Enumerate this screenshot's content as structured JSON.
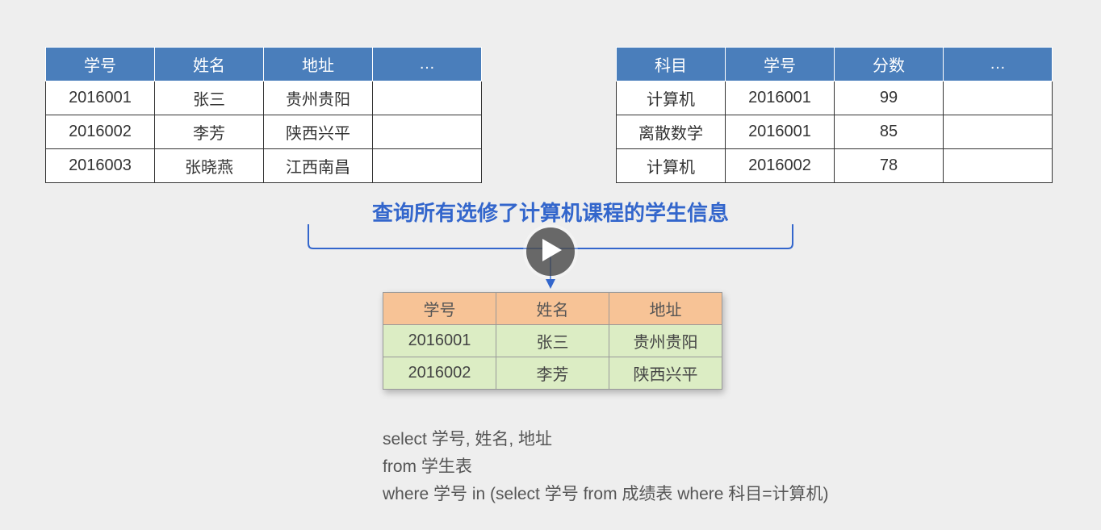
{
  "student_table": {
    "headers": [
      "学号",
      "姓名",
      "地址",
      "…"
    ],
    "rows": [
      [
        "2016001",
        "张三",
        "贵州贵阳",
        ""
      ],
      [
        "2016002",
        "李芳",
        "陕西兴平",
        ""
      ],
      [
        "2016003",
        "张晓燕",
        "江西南昌",
        ""
      ]
    ]
  },
  "score_table": {
    "headers": [
      "科目",
      "学号",
      "分数",
      "…"
    ],
    "rows": [
      [
        "计算机",
        "2016001",
        "99",
        ""
      ],
      [
        "离散数学",
        "2016001",
        "85",
        ""
      ],
      [
        "计算机",
        "2016002",
        "78",
        ""
      ]
    ]
  },
  "heading": "查询所有选修了计算机课程的学生信息",
  "result_table": {
    "headers": [
      "学号",
      "姓名",
      "地址"
    ],
    "rows": [
      [
        "2016001",
        "张三",
        "贵州贵阳"
      ],
      [
        "2016002",
        "李芳",
        "陕西兴平"
      ]
    ]
  },
  "sql": {
    "line1": "select 学号, 姓名, 地址",
    "line2": "from 学生表",
    "line3": "where 学号 in (select 学号 from 成绩表 where 科目=计算机)"
  }
}
